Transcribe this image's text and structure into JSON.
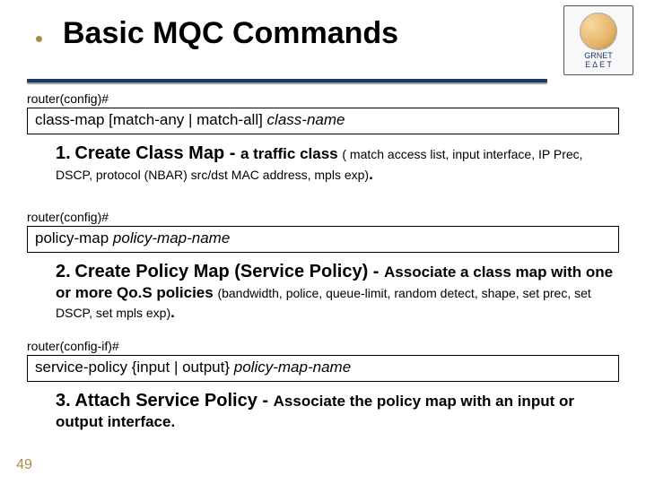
{
  "title": "Basic MQC Commands",
  "logo": {
    "line1": "GRNET",
    "line2": "Ε Δ Ε Τ"
  },
  "steps": [
    {
      "prompt": "router(config)#",
      "command_fixed": "class-map [match-any | match-all] ",
      "command_arg": "class-name",
      "num": "1.",
      "title": "Create Class Map",
      "sep": " - ",
      "lead": "a traffic class ",
      "paren": "( match access list, input interface, IP Prec, DSCP, protocol (NBAR) src/dst MAC address, mpls exp)",
      "tail": "."
    },
    {
      "prompt": "router(config)#",
      "command_fixed": "policy-map ",
      "command_arg": "policy-map-name",
      "num": "2.",
      "title": "Create Policy Map (Service Policy)",
      "sep": " - ",
      "lead": "Associate a class map with one or more Qo.S policies ",
      "paren": "(bandwidth, police,  queue-limit, random detect, shape, set prec, set DSCP, set mpls exp)",
      "tail": "."
    },
    {
      "prompt": "router(config-if)#",
      "command_fixed": "service-policy {input | output} ",
      "command_arg": "policy-map-name",
      "num": "3.",
      "title": "Attach Service Policy",
      "sep": " - ",
      "lead": "Associate the policy map with an input or output interface.",
      "paren": "",
      "tail": ""
    }
  ],
  "slide_number": "49"
}
